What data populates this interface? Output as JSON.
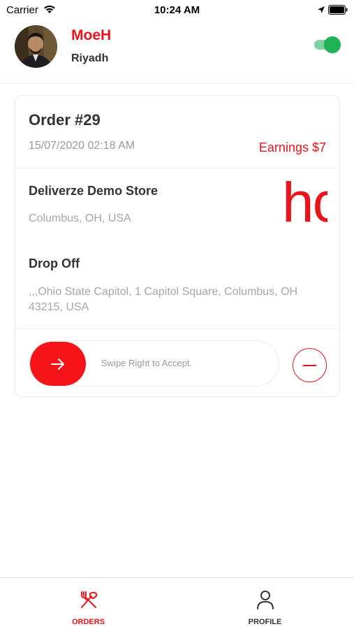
{
  "status_bar": {
    "carrier": "Carrier",
    "time": "10:24 AM"
  },
  "header": {
    "user_name": "MoeH",
    "user_city": "Riyadh",
    "online_toggle": "on"
  },
  "order": {
    "title": "Order #29",
    "date": "15/07/2020 02:18 AM",
    "earnings": "Earnings $7",
    "pickup": {
      "store_name": "Deliverze Demo Store",
      "address": "Columbus, OH, USA",
      "logo_text": "hc"
    },
    "dropoff": {
      "label": "Drop Off",
      "address": ",,,Ohio State Capitol, 1 Capitol Square, Columbus, OH 43215, USA"
    },
    "swipe_label": "Swipe Right to Accept."
  },
  "bottom_nav": {
    "orders_label": "ORDERS",
    "profile_label": "PROFILE"
  },
  "colors": {
    "accent": "#e8141b",
    "toggle_on": "#1fb256",
    "muted_text": "#a6a6a6"
  },
  "icons": [
    "wifi-icon",
    "location-arrow-icon",
    "battery-icon",
    "arrow-right-icon",
    "minus-circle-icon",
    "fork-knife-icon",
    "person-icon"
  ]
}
